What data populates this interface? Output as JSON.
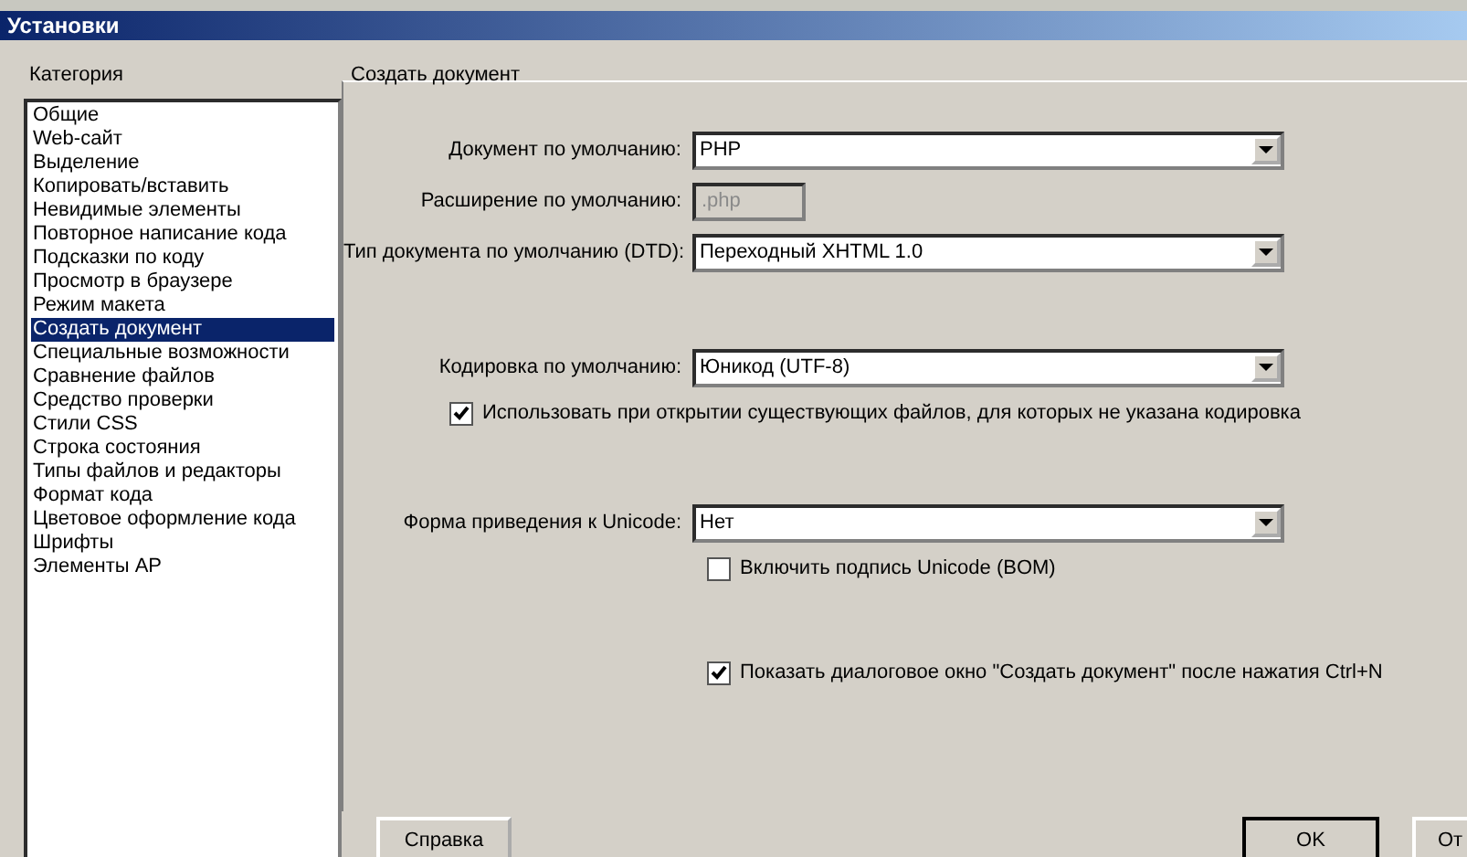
{
  "window": {
    "title": "Установки"
  },
  "category": {
    "label": "Категория",
    "items": [
      {
        "label": "Общие",
        "selected": false
      },
      {
        "label": "Web-сайт",
        "selected": false
      },
      {
        "label": "Выделение",
        "selected": false
      },
      {
        "label": "Копировать/вставить",
        "selected": false
      },
      {
        "label": "Невидимые элементы",
        "selected": false
      },
      {
        "label": "Повторное написание кода",
        "selected": false
      },
      {
        "label": "Подсказки по коду",
        "selected": false
      },
      {
        "label": "Просмотр в браузере",
        "selected": false
      },
      {
        "label": "Режим макета",
        "selected": false
      },
      {
        "label": "Создать документ",
        "selected": true
      },
      {
        "label": "Специальные возможности",
        "selected": false
      },
      {
        "label": "Сравнение файлов",
        "selected": false
      },
      {
        "label": "Средство проверки",
        "selected": false
      },
      {
        "label": "Стили CSS",
        "selected": false
      },
      {
        "label": "Строка состояния",
        "selected": false
      },
      {
        "label": "Типы файлов и редакторы",
        "selected": false
      },
      {
        "label": "Формат кода",
        "selected": false
      },
      {
        "label": "Цветовое оформление кода",
        "selected": false
      },
      {
        "label": "Шрифты",
        "selected": false
      },
      {
        "label": "Элементы AP",
        "selected": false
      }
    ]
  },
  "panel": {
    "title": "Создать документ",
    "groups": [
      [
        {
          "kind": "select",
          "label": "Документ по умолчанию:",
          "value": "PHP"
        },
        {
          "kind": "text",
          "label": "Расширение по умолчанию:",
          "value": ".php",
          "disabled": true
        },
        {
          "kind": "select",
          "label": "Тип документа по умолчанию (DTD):",
          "value": "Переходный XHTML 1.0"
        }
      ],
      [
        {
          "kind": "select",
          "label": "Кодировка по умолчанию:",
          "value": "Юникод (UTF-8)"
        },
        {
          "kind": "checkbox",
          "label": "Использовать при открытии существующих файлов, для которых не указана кодировка",
          "checked": true
        }
      ],
      [
        {
          "kind": "select",
          "label": "Форма приведения к Unicode:",
          "value": "Нет"
        },
        {
          "kind": "checkbox",
          "label": "Включить подпись Unicode (BOM)",
          "checked": false
        }
      ],
      [
        {
          "kind": "checkbox",
          "label": "Показать диалоговое окно \"Создать документ\" после нажатия Ctrl+N",
          "checked": true
        }
      ]
    ]
  },
  "buttons": {
    "help": "Справка",
    "ok": "OK",
    "cancel": "От"
  }
}
